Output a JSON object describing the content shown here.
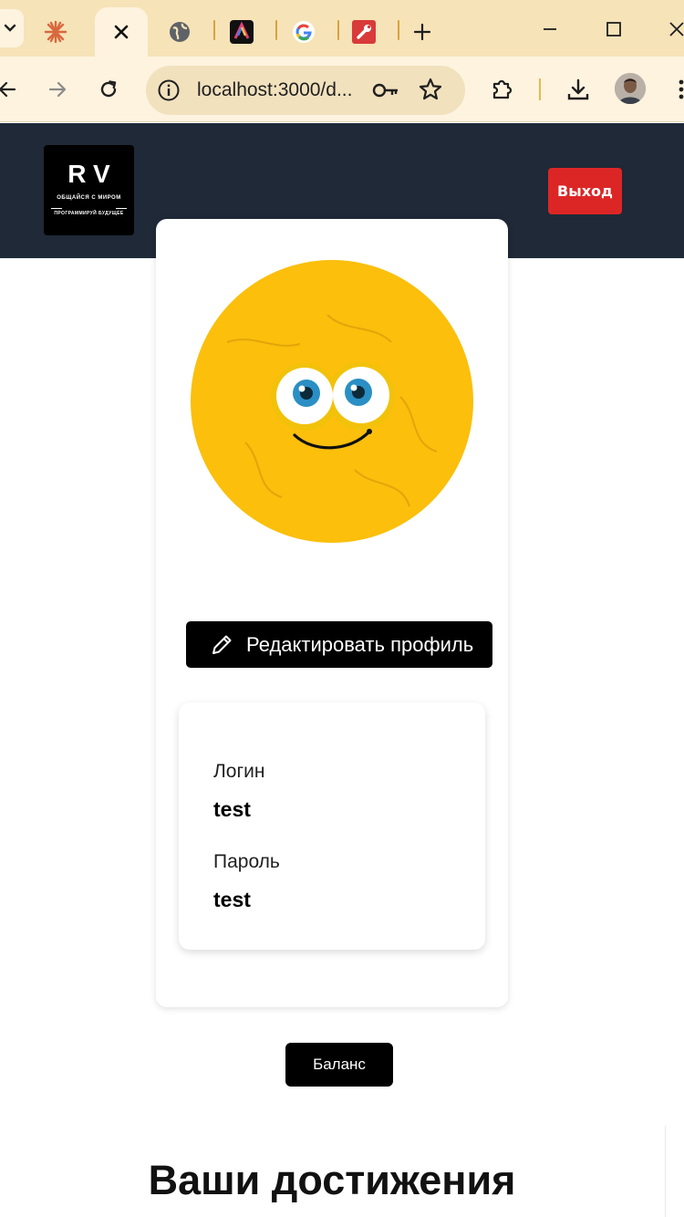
{
  "browser": {
    "tabs": [
      {
        "icon": "sparkle-favicon",
        "active": false
      },
      {
        "icon": "close-icon",
        "active": true
      },
      {
        "icon": "globe-favicon",
        "active": false
      },
      {
        "icon": "arc-logo-favicon",
        "active": false
      },
      {
        "icon": "google-favicon",
        "active": false
      },
      {
        "icon": "wrench-favicon",
        "active": false
      }
    ],
    "new_tab_icon": "plus-icon",
    "url": "localhost:3000/d...",
    "colors": {
      "tabstrip": "#f6e3b8",
      "toolbar": "#fdf3df"
    }
  },
  "header": {
    "logo": {
      "mark": "RV",
      "tagline_top": "ОБЩАЙСЯ С МИРОМ",
      "tagline_bottom": "ПРОГРАММИРУЙ БУДУЩЕЕ"
    },
    "logout_label": "Выход",
    "colors": {
      "background": "#1f2937",
      "logout": "#dc2626"
    }
  },
  "profile": {
    "avatar_icon": "smiley-avatar",
    "edit_button_label": "Редактировать профиль",
    "fields": [
      {
        "label": "Логин",
        "value": "test"
      },
      {
        "label": "Пароль",
        "value": "test"
      }
    ]
  },
  "balance_label": "Баланс",
  "achievements_title": "Ваши достижения"
}
